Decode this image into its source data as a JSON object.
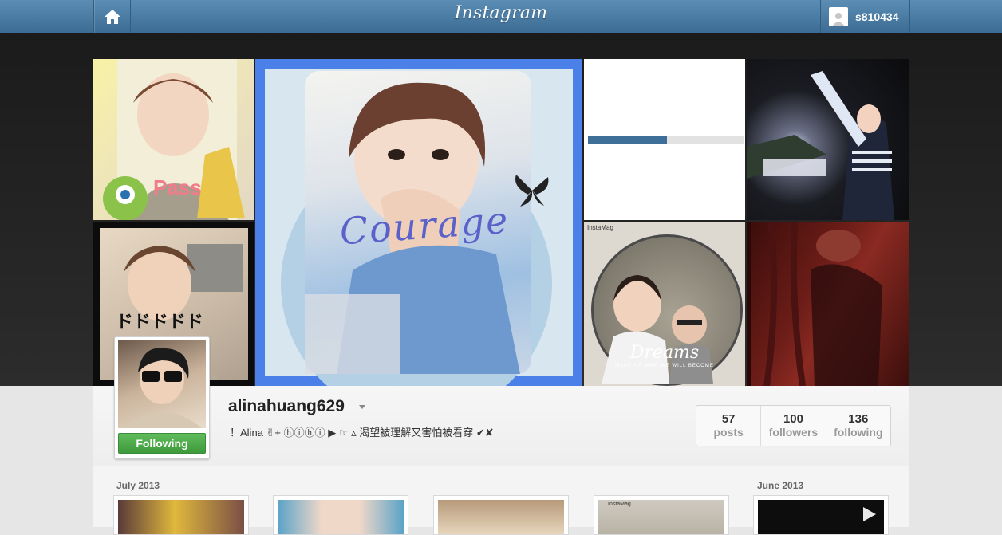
{
  "header": {
    "logo": "Instagram",
    "user": {
      "username": "s810434"
    }
  },
  "banner": {
    "tiles": [
      {
        "id": "t1",
        "overlay_text": "Pass"
      },
      {
        "id": "t2",
        "overlay_text": "ドドドドド"
      },
      {
        "id": "t3",
        "overlay_text": "Courage"
      },
      {
        "id": "t4",
        "loading_progress": 0.5
      },
      {
        "id": "t5"
      },
      {
        "id": "t6",
        "tag": "InstaMag",
        "overlay_text": "Dreams",
        "subtext": "MAKE US WHO WE WILL BECOME"
      },
      {
        "id": "t7"
      }
    ]
  },
  "profile": {
    "username": "alinahuang629",
    "bio": "！Alina ✌︎+ ⓗⓘⓗⓘ ▶︎ ☞ ▵ 渴望被理解又害怕被看穿 ✔︎✘",
    "follow_button": "Following",
    "stats": [
      {
        "value": "57",
        "label": "posts"
      },
      {
        "value": "100",
        "label": "followers"
      },
      {
        "value": "136",
        "label": "following"
      }
    ]
  },
  "feed": {
    "months": [
      {
        "label": "July 2013"
      },
      {
        "label": "June 2013"
      }
    ],
    "thumbs": [
      {
        "tag": ""
      },
      {
        "tag": ""
      },
      {
        "tag": ""
      },
      {
        "tag": "InstaMag"
      },
      {
        "tag": "",
        "type": "video"
      }
    ]
  },
  "colors": {
    "topbar": "#4a7ba5",
    "follow_green": "#4aa847",
    "accent_blue": "#4a80e8"
  },
  "icons": [
    "home-icon",
    "user-avatar-icon",
    "dropdown-caret-icon",
    "play-icon"
  ]
}
